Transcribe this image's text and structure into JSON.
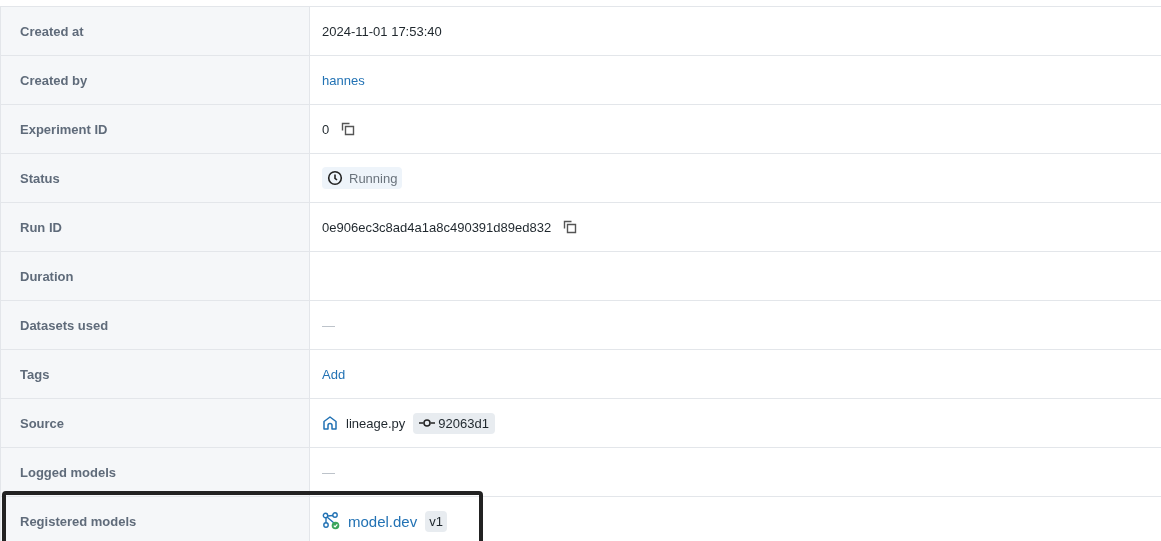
{
  "rows": [
    {
      "label": "Created at",
      "value": {
        "kind": "text",
        "text": "2024-11-01 17:53:40"
      }
    },
    {
      "label": "Created by",
      "value": {
        "kind": "link",
        "text": "hannes"
      }
    },
    {
      "label": "Experiment ID",
      "value": {
        "kind": "copy",
        "text": "0"
      }
    },
    {
      "label": "Status",
      "value": {
        "kind": "status",
        "text": "Running"
      }
    },
    {
      "label": "Run ID",
      "value": {
        "kind": "copy",
        "text": "0e906ec3c8ad4a1a8c490391d89ed832"
      }
    },
    {
      "label": "Duration",
      "value": {
        "kind": "empty"
      }
    },
    {
      "label": "Datasets used",
      "value": {
        "kind": "dash",
        "text": "—"
      }
    },
    {
      "label": "Tags",
      "value": {
        "kind": "link",
        "text": "Add"
      }
    },
    {
      "label": "Source",
      "value": {
        "kind": "source",
        "text": "lineage.py",
        "commit": "92063d1"
      }
    },
    {
      "label": "Logged models",
      "value": {
        "kind": "dash",
        "text": "—"
      }
    },
    {
      "label": "Registered models",
      "highlighted": true,
      "value": {
        "kind": "model",
        "text": "model.dev",
        "version": "v1"
      }
    }
  ]
}
